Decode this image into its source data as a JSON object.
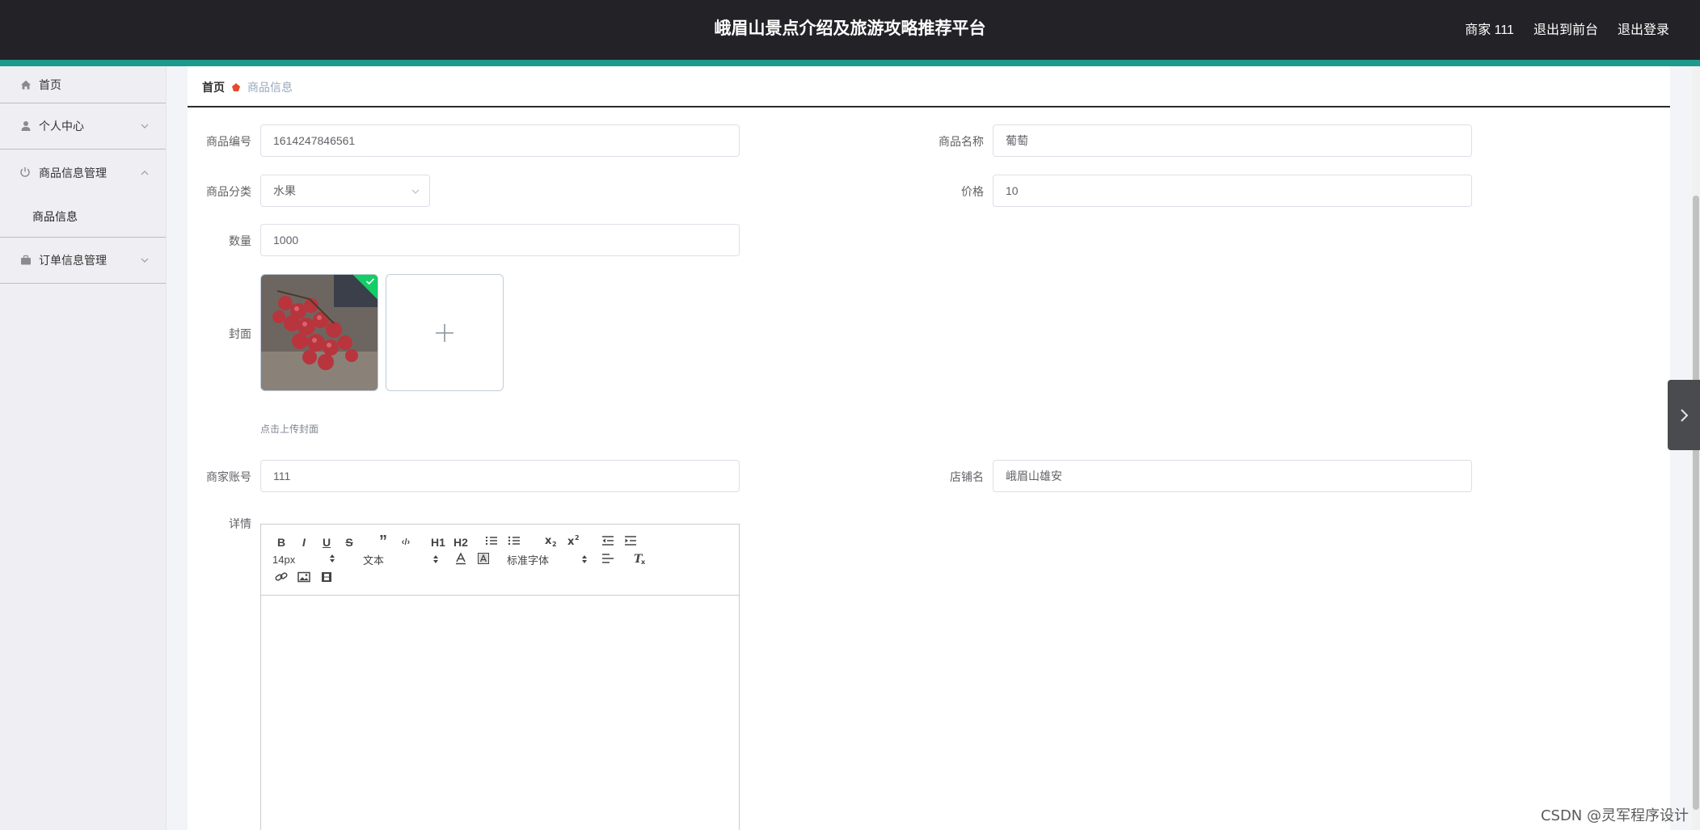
{
  "header": {
    "title": "峨眉山景点介绍及旅游攻略推荐平台",
    "user": "商家 111",
    "to_front": "退出到前台",
    "logout": "退出登录",
    "accent_color": "#1d9a8a"
  },
  "sidebar": {
    "items": [
      {
        "label": "首页",
        "icon": "home-icon"
      },
      {
        "label": "个人中心",
        "icon": "user-icon"
      },
      {
        "label": "商品信息管理",
        "icon": "power-icon",
        "children": [
          "商品信息"
        ]
      },
      {
        "label": "订单信息管理",
        "icon": "briefcase-icon"
      }
    ]
  },
  "breadcrumb": {
    "home": "首页",
    "current": "商品信息"
  },
  "form": {
    "code_label": "商品编号",
    "code_value": "1614247846561",
    "name_label": "商品名称",
    "name_value": "葡萄",
    "category_label": "商品分类",
    "category_value": "水果",
    "price_label": "价格",
    "price_value": "10",
    "qty_label": "数量",
    "qty_value": "1000",
    "cover_label": "封面",
    "cover_hint": "点击上传封面",
    "account_label": "商家账号",
    "account_value": "111",
    "shop_label": "店铺名",
    "shop_value": "峨眉山雄安",
    "detail_label": "详情"
  },
  "editor": {
    "buttons_row1": [
      "B",
      "I",
      "U",
      "S",
      "”",
      "‹/›",
      "H1",
      "H2"
    ],
    "font_size": "14px",
    "text_type": "文本",
    "font_family": "标准字体"
  },
  "watermark": "CSDN @灵军程序设计"
}
